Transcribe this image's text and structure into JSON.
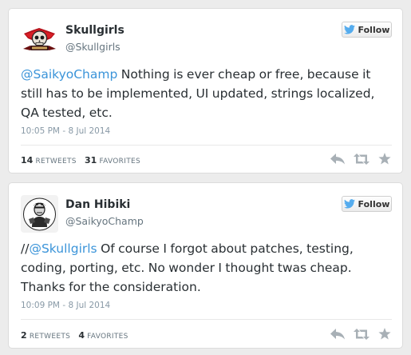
{
  "tweets": [
    {
      "display_name": "Skullgirls",
      "handle": "@Skullgirls",
      "follow_label": "Follow",
      "text_mention": "@SaikyoChamp",
      "text_body": " Nothing is ever cheap or free, because it still has to be implemented, UI updated, strings localized, QA tested, etc.",
      "timestamp": "10:05 PM - 8 Jul 2014",
      "retweets": "14",
      "retweets_label": "RETWEETS",
      "favorites": "31",
      "favorites_label": "FAVORITES",
      "avatar_icon": "skullgirls-logo"
    },
    {
      "display_name": "Dan Hibiki",
      "handle": "@SaikyoChamp",
      "follow_label": "Follow",
      "text_prefix": "//",
      "text_mention": "@Skullgirls",
      "text_body": " Of course I forgot about patches, testing, coding, porting, etc. No wonder I thought twas cheap. Thanks for the consideration.",
      "timestamp": "10:09 PM - 8 Jul 2014",
      "retweets": "2",
      "retweets_label": "RETWEETS",
      "favorites": "4",
      "favorites_label": "FAVORITES",
      "avatar_icon": "dan-hibiki-portrait"
    }
  ],
  "icons": {
    "follow": "twitter-bird-icon",
    "reply": "reply-icon",
    "retweet": "retweet-icon",
    "favorite": "star-icon"
  },
  "colors": {
    "link": "#3b94d9",
    "twitter_blue": "#55acee",
    "text": "#292f33",
    "muted": "#8899a6",
    "action_icon": "#a8b0b6"
  }
}
